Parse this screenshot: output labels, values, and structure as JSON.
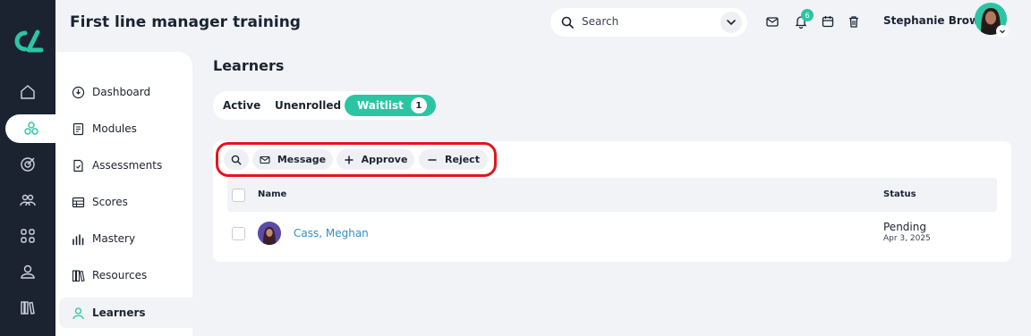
{
  "header": {
    "course_title": "First line manager training",
    "search_placeholder": "Search",
    "notification_count": "6",
    "user_name": "Stephanie Brown"
  },
  "rail": {
    "items": [
      {
        "icon": "home-icon"
      },
      {
        "icon": "modules-cubes-icon",
        "active": true
      },
      {
        "icon": "target-icon"
      },
      {
        "icon": "users-icon"
      },
      {
        "icon": "grid-icon"
      },
      {
        "icon": "person-icon"
      },
      {
        "icon": "library-icon"
      }
    ]
  },
  "sidebar": {
    "items": [
      {
        "label": "Dashboard",
        "icon": "dashboard-icon"
      },
      {
        "label": "Modules",
        "icon": "modules-icon"
      },
      {
        "label": "Assessments",
        "icon": "assessments-icon"
      },
      {
        "label": "Scores",
        "icon": "scores-icon"
      },
      {
        "label": "Mastery",
        "icon": "mastery-icon"
      },
      {
        "label": "Resources",
        "icon": "resources-icon"
      },
      {
        "label": "Learners",
        "icon": "learners-icon",
        "active": true
      }
    ]
  },
  "main": {
    "title": "Learners",
    "tabs": [
      {
        "label": "Active"
      },
      {
        "label": "Unenrolled"
      },
      {
        "label": "Waitlist",
        "count": "1",
        "active": true
      }
    ],
    "toolbar": {
      "message_label": "Message",
      "approve_label": "Approve",
      "reject_label": "Reject"
    },
    "table": {
      "columns": [
        "Name",
        "Status"
      ],
      "rows": [
        {
          "name": "Cass, Meghan",
          "status": "Pending",
          "date": "Apr 3, 2025"
        }
      ]
    }
  },
  "colors": {
    "accent": "#2cc5a3",
    "rail": "#1b2331",
    "link": "#2f8ecf",
    "highlight": "#e3141b"
  }
}
